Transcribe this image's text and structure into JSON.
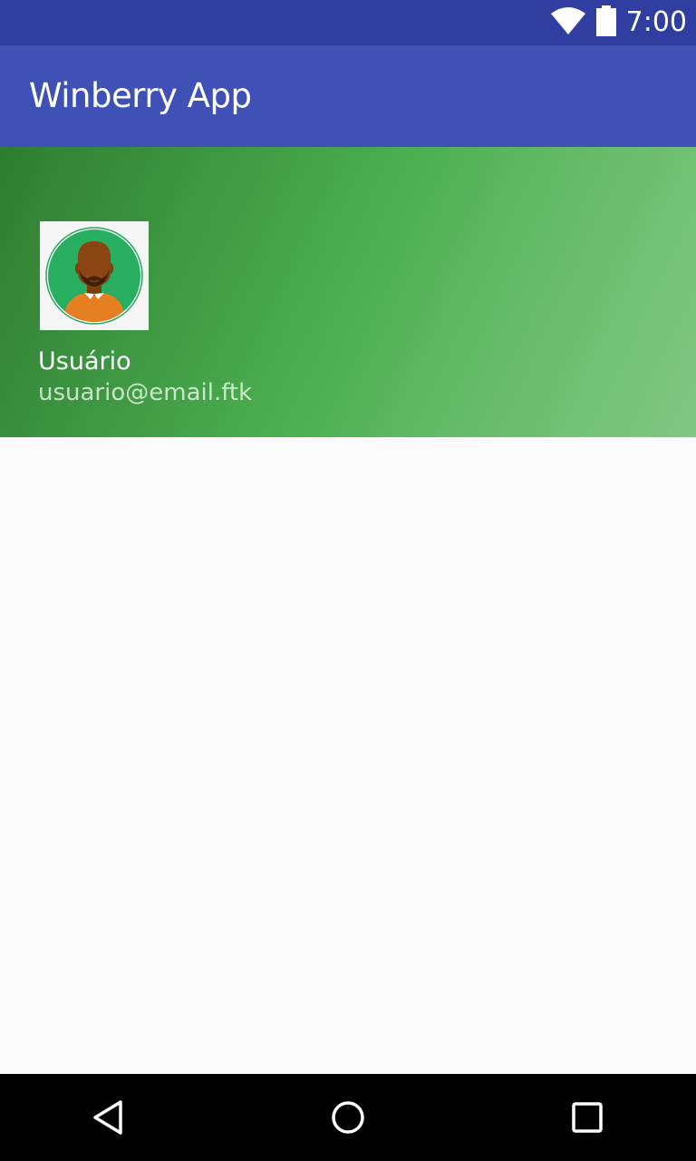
{
  "status_bar": {
    "time": "7:00",
    "icons": [
      "wifi-icon",
      "battery-icon"
    ],
    "background": "#303f9f"
  },
  "app_bar": {
    "title": "Winberry App",
    "background": "#3f51b5"
  },
  "drawer_header": {
    "avatar": "user-avatar-icon",
    "user_name": "Usuário",
    "user_email": "usuario@email.ftk",
    "gradient_start": "#2e7d32",
    "gradient_end": "#81c784"
  },
  "navigation_bar": {
    "buttons": [
      "back-icon",
      "home-icon",
      "recents-icon"
    ]
  }
}
